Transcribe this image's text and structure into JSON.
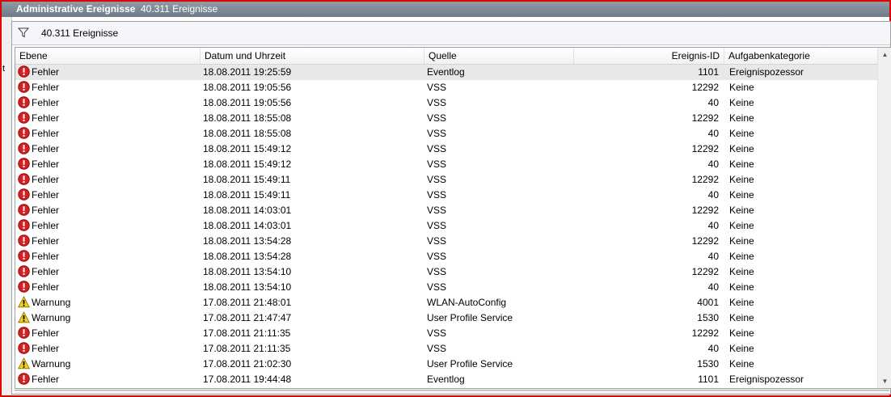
{
  "window": {
    "title": "Administrative Ereignisse",
    "count": "40.311 Ereignisse",
    "left_char": "t"
  },
  "filter": {
    "icon": "filter-icon",
    "label": "40.311 Ereignisse"
  },
  "columns": {
    "level": "Ebene",
    "date": "Datum und Uhrzeit",
    "source": "Quelle",
    "id": "Ereignis-ID",
    "category": "Aufgabenkategorie"
  },
  "colors": {
    "error": "#d42020",
    "warning": "#f2d21b",
    "frame": "#e00000"
  },
  "rows": [
    {
      "level": "Fehler",
      "type": "error",
      "date": "18.08.2011 19:25:59",
      "source": "Eventlog",
      "id": "1101",
      "category": "Ereignispozessor"
    },
    {
      "level": "Fehler",
      "type": "error",
      "date": "18.08.2011 19:05:56",
      "source": "VSS",
      "id": "12292",
      "category": "Keine"
    },
    {
      "level": "Fehler",
      "type": "error",
      "date": "18.08.2011 19:05:56",
      "source": "VSS",
      "id": "40",
      "category": "Keine"
    },
    {
      "level": "Fehler",
      "type": "error",
      "date": "18.08.2011 18:55:08",
      "source": "VSS",
      "id": "12292",
      "category": "Keine"
    },
    {
      "level": "Fehler",
      "type": "error",
      "date": "18.08.2011 18:55:08",
      "source": "VSS",
      "id": "40",
      "category": "Keine"
    },
    {
      "level": "Fehler",
      "type": "error",
      "date": "18.08.2011 15:49:12",
      "source": "VSS",
      "id": "12292",
      "category": "Keine"
    },
    {
      "level": "Fehler",
      "type": "error",
      "date": "18.08.2011 15:49:12",
      "source": "VSS",
      "id": "40",
      "category": "Keine"
    },
    {
      "level": "Fehler",
      "type": "error",
      "date": "18.08.2011 15:49:11",
      "source": "VSS",
      "id": "12292",
      "category": "Keine"
    },
    {
      "level": "Fehler",
      "type": "error",
      "date": "18.08.2011 15:49:11",
      "source": "VSS",
      "id": "40",
      "category": "Keine"
    },
    {
      "level": "Fehler",
      "type": "error",
      "date": "18.08.2011 14:03:01",
      "source": "VSS",
      "id": "12292",
      "category": "Keine"
    },
    {
      "level": "Fehler",
      "type": "error",
      "date": "18.08.2011 14:03:01",
      "source": "VSS",
      "id": "40",
      "category": "Keine"
    },
    {
      "level": "Fehler",
      "type": "error",
      "date": "18.08.2011 13:54:28",
      "source": "VSS",
      "id": "12292",
      "category": "Keine"
    },
    {
      "level": "Fehler",
      "type": "error",
      "date": "18.08.2011 13:54:28",
      "source": "VSS",
      "id": "40",
      "category": "Keine"
    },
    {
      "level": "Fehler",
      "type": "error",
      "date": "18.08.2011 13:54:10",
      "source": "VSS",
      "id": "12292",
      "category": "Keine"
    },
    {
      "level": "Fehler",
      "type": "error",
      "date": "18.08.2011 13:54:10",
      "source": "VSS",
      "id": "40",
      "category": "Keine"
    },
    {
      "level": "Warnung",
      "type": "warning",
      "date": "17.08.2011 21:48:01",
      "source": "WLAN-AutoConfig",
      "id": "4001",
      "category": "Keine"
    },
    {
      "level": "Warnung",
      "type": "warning",
      "date": "17.08.2011 21:47:47",
      "source": "User Profile Service",
      "id": "1530",
      "category": "Keine"
    },
    {
      "level": "Fehler",
      "type": "error",
      "date": "17.08.2011 21:11:35",
      "source": "VSS",
      "id": "12292",
      "category": "Keine"
    },
    {
      "level": "Fehler",
      "type": "error",
      "date": "17.08.2011 21:11:35",
      "source": "VSS",
      "id": "40",
      "category": "Keine"
    },
    {
      "level": "Warnung",
      "type": "warning",
      "date": "17.08.2011 21:02:30",
      "source": "User Profile Service",
      "id": "1530",
      "category": "Keine"
    },
    {
      "level": "Fehler",
      "type": "error",
      "date": "17.08.2011 19:44:48",
      "source": "Eventlog",
      "id": "1101",
      "category": "Ereignispozessor"
    }
  ]
}
